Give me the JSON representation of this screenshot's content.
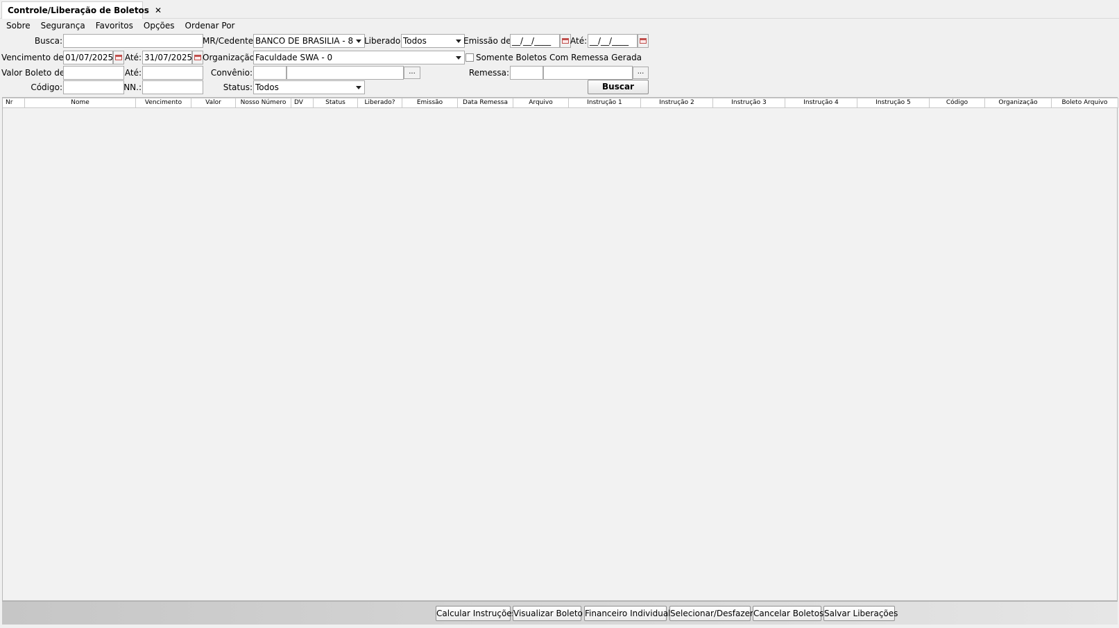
{
  "tab": {
    "title": "Controle/Liberação de Boletos",
    "close_label": "✕"
  },
  "menu": [
    "Sobre",
    "Segurança",
    "Favoritos",
    "Opções",
    "Ordenar Por"
  ],
  "form": {
    "busca_label": "Busca:",
    "busca_value": "",
    "mr_cedente_label": "MR/Cedente:",
    "mr_cedente_value": "BANCO DE BRASILIA - 8",
    "liberado_label": "Liberado:",
    "liberado_value": "Todos",
    "emissao_de_label": "Emissão de:",
    "emissao_de_value": "__/__/____",
    "emissao_ate_label": "Até:",
    "emissao_ate_value": "__/__/____",
    "vencimento_de_label": "Vencimento de:",
    "vencimento_de_value": "01/07/2025",
    "vencimento_ate_label": "Até:",
    "vencimento_ate_value": "31/07/2025",
    "organizacao_label": "Organização:",
    "organizacao_value": "Faculdade SWA - 0",
    "somente_remessa_label": "Somente Boletos Com Remessa Gerada",
    "valor_de_label": "Valor Boleto de:",
    "valor_ate_label": "Até:",
    "convenio_label": "Convênio:",
    "remessa_label": "Remessa:",
    "codigo_label": "Código:",
    "nn_label": "NN.:",
    "status_label": "Status:",
    "status_value": "Todos",
    "lookup_label": "...",
    "buscar_label": "Buscar"
  },
  "table": {
    "columns": [
      "Nr",
      "Nome",
      "Vencimento",
      "Valor",
      "Nosso Número",
      "DV",
      "Status",
      "Liberado?",
      "Emissão",
      "Data Remessa",
      "Arquivo",
      "Instrução 1",
      "Instrução 2",
      "Instrução 3",
      "Instrução 4",
      "Instrução 5",
      "Código",
      "Organização",
      "Boleto Arquivo"
    ],
    "rows": []
  },
  "footer_buttons": [
    "Calcular Instruções",
    "Visualizar Boleto",
    "Financeiro Individual",
    "Selecionar/Desfazer",
    "Cancelar Boletos",
    "Salvar Liberações"
  ],
  "colors": {
    "grid_bg": "#f2f2f2",
    "calendar_icon": "#c0504d"
  }
}
